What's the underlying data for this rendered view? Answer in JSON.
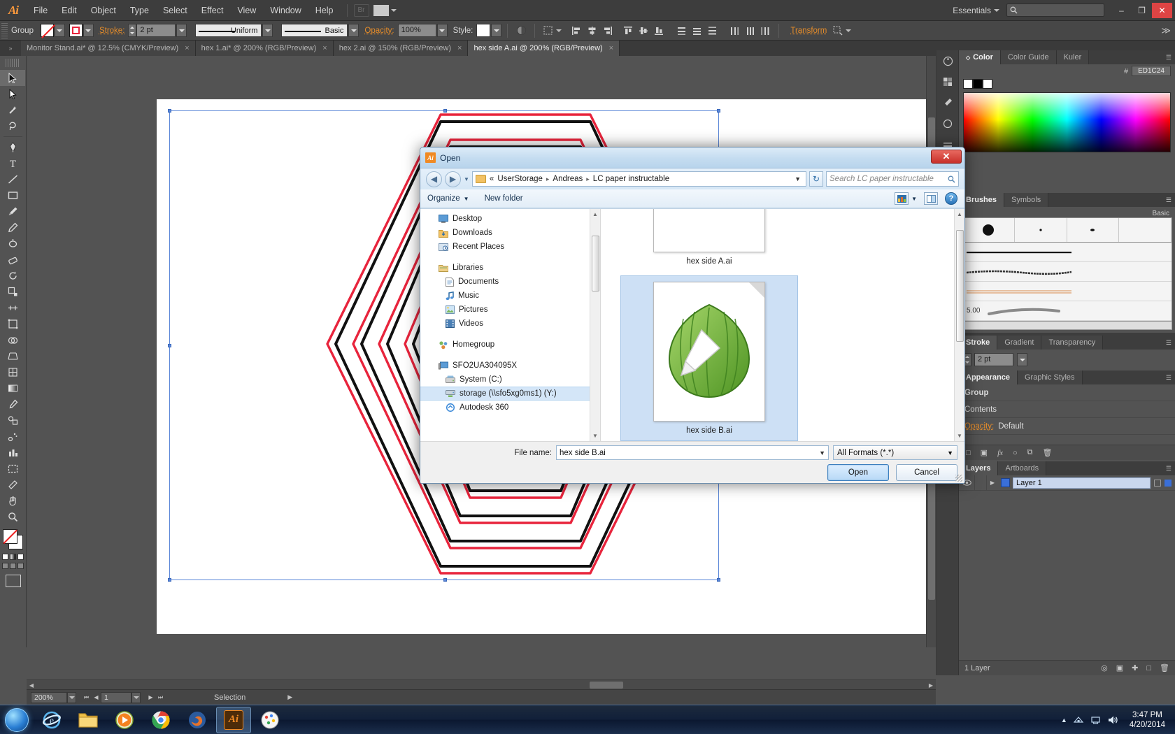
{
  "app": {
    "logo": "Ai",
    "menus": [
      "File",
      "Edit",
      "Object",
      "Type",
      "Select",
      "Effect",
      "View",
      "Window",
      "Help"
    ],
    "bridge_label": "Br",
    "workspace": "Essentials",
    "search_placeholder": "",
    "window_buttons": {
      "minimize": "–",
      "maximize": "❐",
      "close": "✕"
    }
  },
  "control_bar": {
    "selection_label": "Group",
    "stroke_label": "Stroke:",
    "stroke_weight": "2 pt",
    "profile": "Uniform",
    "brush": "Basic",
    "opacity_label": "Opacity:",
    "opacity_value": "100%",
    "style_label": "Style:",
    "transform_label": "Transform"
  },
  "tabs": [
    {
      "label": "Monitor Stand.ai* @ 12.5% (CMYK/Preview)",
      "close": "×",
      "active": false
    },
    {
      "label": "hex 1.ai* @ 200% (RGB/Preview)",
      "close": "×",
      "active": false
    },
    {
      "label": "hex 2.ai @ 150% (RGB/Preview)",
      "close": "×",
      "active": false
    },
    {
      "label": "hex side A.ai @ 200% (RGB/Preview)",
      "close": "×",
      "active": true
    }
  ],
  "status_bar": {
    "zoom": "200%",
    "page": "1",
    "tool": "Selection"
  },
  "panels": {
    "color": {
      "tabs": [
        "Color",
        "Color Guide",
        "Kuler"
      ],
      "active_tab": "Color",
      "hex_prefix": "#",
      "hex_value": "ED1C24"
    },
    "brushes": {
      "tabs": [
        "Brushes",
        "Symbols"
      ],
      "active_tab": "Brushes",
      "basic_label": "Basic",
      "size_label": "5.00"
    },
    "stroke": {
      "tabs": [
        "Stroke",
        "Gradient",
        "Transparency"
      ],
      "active_tab": "Stroke",
      "weight": "2 pt"
    },
    "appearance": {
      "tabs": [
        "Appearance",
        "Graphic Styles"
      ],
      "active_tab": "Appearance",
      "rows": [
        "Group",
        "Contents"
      ],
      "opacity_label": "Opacity:",
      "opacity_value": "Default"
    },
    "layers": {
      "tabs": [
        "Layers",
        "Artboards"
      ],
      "active_tab": "Layers",
      "items": [
        {
          "name": "Layer 1"
        }
      ],
      "footer_count": "1 Layer"
    }
  },
  "dialog": {
    "title": "Open",
    "close_label": "✕",
    "breadcrumb": {
      "prefix": "«",
      "parts": [
        "UserStorage",
        "Andreas",
        "LC paper instructable"
      ],
      "separator": "▸"
    },
    "search_placeholder": "Search LC paper instructable",
    "organize_label": "Organize",
    "new_folder_label": "New folder",
    "nav_items": [
      {
        "label": "Desktop",
        "icon": "desktop-icon",
        "indent": false,
        "selected": false
      },
      {
        "label": "Downloads",
        "icon": "downloads-icon",
        "indent": false,
        "selected": false
      },
      {
        "label": "Recent Places",
        "icon": "recent-icon",
        "indent": false,
        "selected": false
      },
      {
        "label": "Libraries",
        "icon": "libraries-icon",
        "indent": false,
        "selected": false
      },
      {
        "label": "Documents",
        "icon": "documents-icon",
        "indent": true,
        "selected": false
      },
      {
        "label": "Music",
        "icon": "music-icon",
        "indent": true,
        "selected": false
      },
      {
        "label": "Pictures",
        "icon": "pictures-icon",
        "indent": true,
        "selected": false
      },
      {
        "label": "Videos",
        "icon": "videos-icon",
        "indent": true,
        "selected": false
      },
      {
        "label": "Homegroup",
        "icon": "homegroup-icon",
        "indent": false,
        "selected": false
      },
      {
        "label": "SFO2UA304095X",
        "icon": "computer-icon",
        "indent": false,
        "selected": false
      },
      {
        "label": "System (C:)",
        "icon": "drive-icon",
        "indent": true,
        "selected": false
      },
      {
        "label": "storage (\\\\sfo5xg0ms1) (Y:)",
        "icon": "network-drive-icon",
        "indent": true,
        "selected": true
      },
      {
        "label": "Autodesk 360",
        "icon": "autodesk-icon",
        "indent": true,
        "selected": false
      }
    ],
    "files": [
      {
        "label": "hex side A.ai",
        "selected": false
      },
      {
        "label": "hex side B.ai",
        "selected": true
      }
    ],
    "file_name_label": "File name:",
    "file_name_value": "hex side B.ai",
    "format_value": "All Formats (*.*)",
    "open_button": "Open",
    "cancel_button": "Cancel"
  },
  "taskbar": {
    "items": [
      "start-orb",
      "internet-explorer",
      "explorer",
      "media-player",
      "chrome",
      "firefox",
      "illustrator",
      "paint"
    ],
    "clock_time": "3:47 PM",
    "clock_date": "4/20/2014"
  }
}
